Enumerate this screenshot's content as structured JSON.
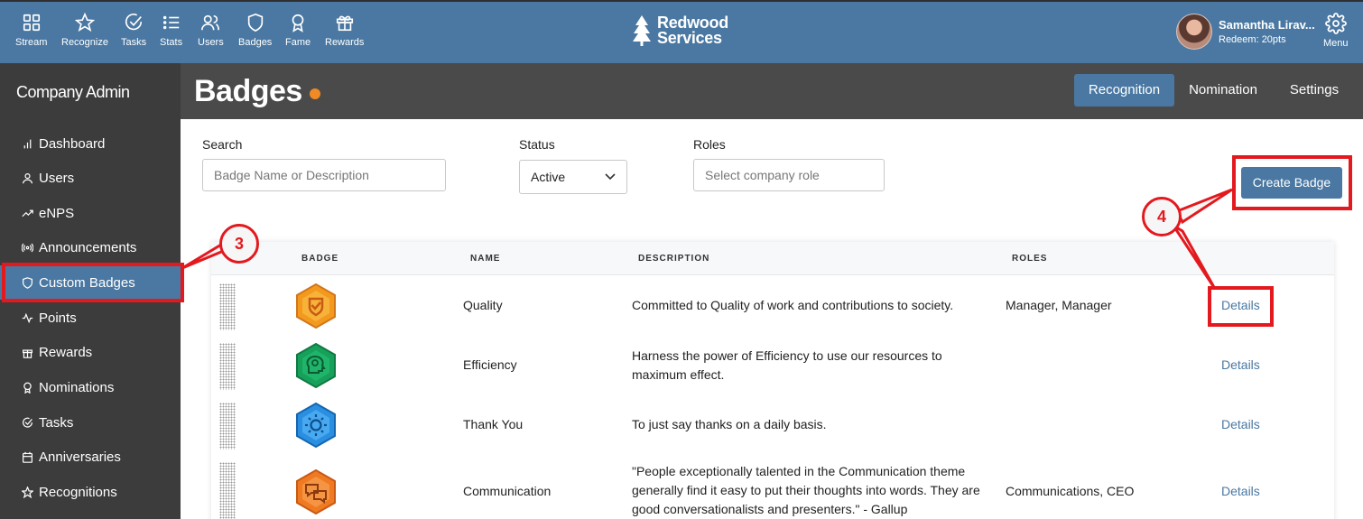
{
  "topnav": {
    "items": [
      {
        "label": "Stream",
        "icon": "grid-icon"
      },
      {
        "label": "Recognize",
        "icon": "star-icon"
      },
      {
        "label": "Tasks",
        "icon": "check-circle-icon"
      },
      {
        "label": "Stats",
        "icon": "list-icon"
      },
      {
        "label": "Users",
        "icon": "users-icon"
      },
      {
        "label": "Badges",
        "icon": "shield-icon"
      },
      {
        "label": "Fame",
        "icon": "award-icon"
      },
      {
        "label": "Rewards",
        "icon": "gift-icon"
      }
    ],
    "logo_line1": "Redwood",
    "logo_line2": "Services",
    "user_name": "Samantha Lirav...",
    "user_sub": "Redeem: 20pts",
    "menu_label": "Menu"
  },
  "sidebar": {
    "title": "Company Admin",
    "items": [
      {
        "label": "Dashboard",
        "icon": "bar-chart-icon"
      },
      {
        "label": "Users",
        "icon": "user-icon"
      },
      {
        "label": "eNPS",
        "icon": "trending-up-icon"
      },
      {
        "label": "Announcements",
        "icon": "broadcast-icon"
      },
      {
        "label": "Custom Badges",
        "icon": "shield-icon"
      },
      {
        "label": "Points",
        "icon": "activity-icon"
      },
      {
        "label": "Rewards",
        "icon": "gift-icon"
      },
      {
        "label": "Nominations",
        "icon": "award-icon"
      },
      {
        "label": "Tasks",
        "icon": "check-circle-icon"
      },
      {
        "label": "Anniversaries",
        "icon": "calendar-icon"
      },
      {
        "label": "Recognitions",
        "icon": "star-icon"
      }
    ]
  },
  "header": {
    "title": "Badges",
    "tabs": [
      {
        "label": "Recognition"
      },
      {
        "label": "Nomination"
      },
      {
        "label": "Settings"
      }
    ]
  },
  "filters": {
    "search_label": "Search",
    "search_placeholder": "Badge Name or Description",
    "status_label": "Status",
    "status_value": "Active",
    "roles_label": "Roles",
    "roles_placeholder": "Select company role",
    "create_label": "Create Badge"
  },
  "table": {
    "headers": [
      "BADGE",
      "NAME",
      "DESCRIPTION",
      "ROLES"
    ],
    "rows": [
      {
        "name": "Quality",
        "description": "Committed to Quality of work and contributions to society.",
        "roles": "Manager, Manager",
        "details": "Details",
        "badge_color": "#f39a1e",
        "badge_icon": "shield-check-icon"
      },
      {
        "name": "Efficiency",
        "description": "Harness the power of Efficiency to use our resources to maximum effect.",
        "roles": "",
        "details": "Details",
        "badge_color": "#17a05a",
        "badge_icon": "head-gear-icon"
      },
      {
        "name": "Thank You",
        "description": "To just say thanks on a daily basis.",
        "roles": "",
        "details": "Details",
        "badge_color": "#2a8fe0",
        "badge_icon": "sun-icon"
      },
      {
        "name": "Communication",
        "description": "\"People exceptionally talented in the Communication theme generally find it easy to put their thoughts into words. They are good conversationalists and presenters.\" - Gallup",
        "roles": "Communications, CEO",
        "details": "Details",
        "badge_color": "#f07a22",
        "badge_icon": "chat-bubbles-icon"
      }
    ]
  },
  "annotations": {
    "step3": "3",
    "step4": "4",
    "color": "#e3191e"
  }
}
